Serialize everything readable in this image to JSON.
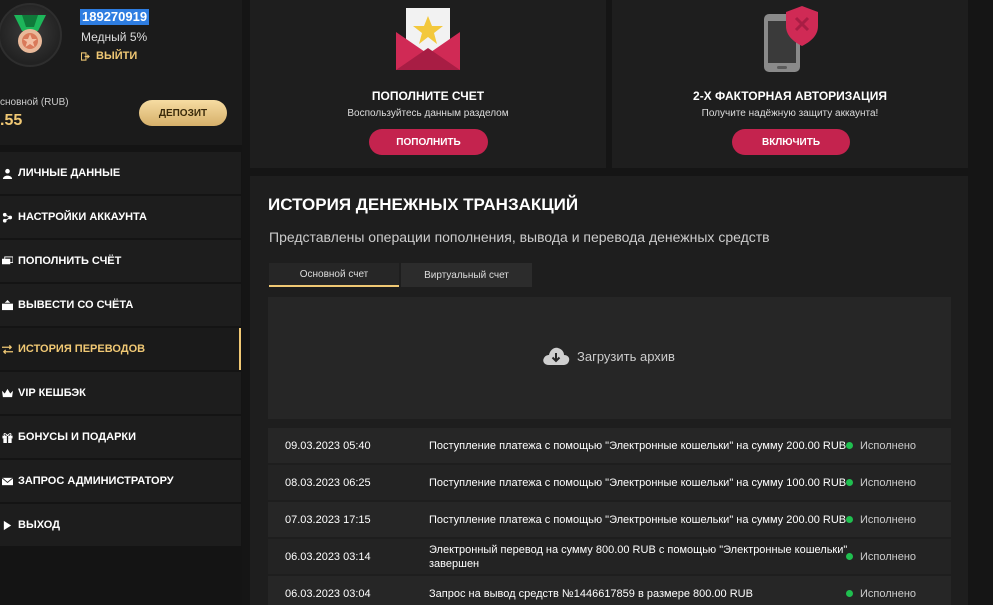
{
  "profile": {
    "user_id": "189270919",
    "level": "Медный 5%",
    "logout_label": "ВЫЙТИ",
    "balance_label": "сновной (RUB)",
    "balance_value": ".55",
    "deposit_label": "ДЕПОЗИТ"
  },
  "menu": {
    "items": [
      {
        "label": "ЛИЧНЫЕ ДАННЫЕ",
        "icon": "user-icon"
      },
      {
        "label": "НАСТРОЙКИ АККАУНТА",
        "icon": "settings-icon"
      },
      {
        "label": "ПОПОЛНИТЬ СЧЁТ",
        "icon": "cards-icon"
      },
      {
        "label": "ВЫВЕСТИ СО СЧЁТА",
        "icon": "withdraw-icon"
      },
      {
        "label": "ИСТОРИЯ ПЕРЕВОДОВ",
        "icon": "transfer-icon",
        "active": true
      },
      {
        "label": "VIP КЕШБЭК",
        "icon": "crown-icon"
      },
      {
        "label": "БОНУСЫ И ПОДАРКИ",
        "icon": "gift-icon"
      },
      {
        "label": "ЗАПРОС АДМИНИСТРАТОРУ",
        "icon": "mail-icon"
      },
      {
        "label": "ВЫХОД",
        "icon": "exit-icon"
      }
    ]
  },
  "cards": {
    "deposit": {
      "title": "ПОПОЛНИТЕ СЧЕТ",
      "subtitle": "Воспользуйтесь данным разделом",
      "button": "ПОПОЛНИТЬ",
      "icon": "envelope-star-icon"
    },
    "twofa": {
      "title": "2-Х ФАКТОРНАЯ АВТОРИЗАЦИЯ",
      "subtitle": "Получите надёжную защиту аккаунта!",
      "button": "ВКЛЮЧИТЬ",
      "icon": "phone-shield-icon"
    }
  },
  "main": {
    "title": "ИСТОРИЯ ДЕНЕЖНЫХ ТРАНЗАКЦИЙ",
    "description": "Представлены операции пополнения, вывода и перевода денежных средств",
    "tabs": [
      {
        "label": "Основной счет",
        "active": true
      },
      {
        "label": "Виртуальный счет",
        "active": false
      }
    ],
    "archive_label": "Загрузить архив"
  },
  "transactions": [
    {
      "date": "09.03.2023 05:40",
      "description": "Поступление платежа с помощью \"Электронные кошельки\" на сумму 200.00 RUB",
      "status": "Исполнено"
    },
    {
      "date": "08.03.2023 06:25",
      "description": "Поступление платежа с помощью \"Электронные кошельки\" на сумму 100.00 RUB",
      "status": "Исполнено"
    },
    {
      "date": "07.03.2023 17:15",
      "description": "Поступление платежа с помощью \"Электронные кошельки\" на сумму 200.00 RUB",
      "status": "Исполнено"
    },
    {
      "date": "06.03.2023 03:14",
      "description": "Электронный перевод на сумму 800.00 RUB с помощью \"Электронные кошельки\" завершен",
      "status": "Исполнено"
    },
    {
      "date": "06.03.2023 03:04",
      "description": "Запрос на вывод средств №1446617859 в размере 800.00 RUB",
      "status": "Исполнено"
    }
  ],
  "colors": {
    "accent": "#f0c874",
    "button": "#c4234e",
    "success": "#1fbf4f"
  }
}
